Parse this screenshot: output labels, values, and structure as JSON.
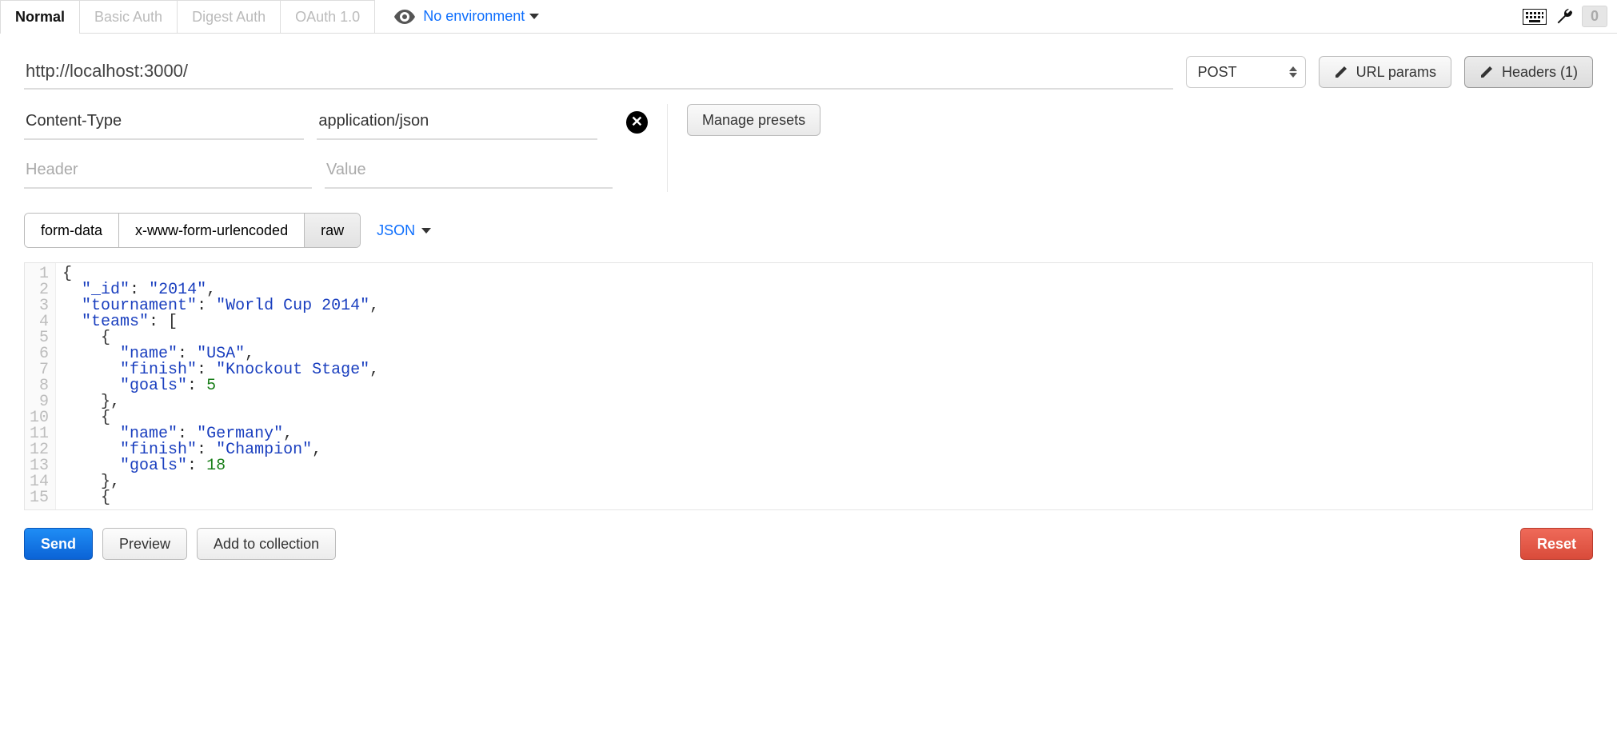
{
  "tabs": {
    "auth": {
      "normal": "Normal",
      "basic": "Basic Auth",
      "digest": "Digest Auth",
      "oauth": "OAuth 1.0",
      "active": "normal"
    },
    "environment": {
      "label": "No environment"
    }
  },
  "top_right": {
    "count": "0"
  },
  "request": {
    "url": "http://localhost:3000/",
    "method_selected": "POST"
  },
  "toolbar": {
    "url_params": "URL params",
    "headers_btn": "Headers (1)"
  },
  "headers": {
    "rows": [
      {
        "name": "Content-Type",
        "value": "application/json"
      }
    ],
    "placeholder_name": "Header",
    "placeholder_value": "Value",
    "manage_presets": "Manage presets"
  },
  "body_tabs": {
    "form_data": "form-data",
    "urlencoded": "x-www-form-urlencoded",
    "raw": "raw",
    "active": "raw",
    "body_type": "JSON"
  },
  "editor": {
    "lines": [
      [
        {
          "t": "brace",
          "v": "{"
        }
      ],
      [
        {
          "t": "pad",
          "v": "  "
        },
        {
          "t": "key",
          "v": "\"_id\""
        },
        {
          "t": "punc",
          "v": ": "
        },
        {
          "t": "str",
          "v": "\"2014\""
        },
        {
          "t": "punc",
          "v": ","
        }
      ],
      [
        {
          "t": "pad",
          "v": "  "
        },
        {
          "t": "key",
          "v": "\"tournament\""
        },
        {
          "t": "punc",
          "v": ": "
        },
        {
          "t": "str",
          "v": "\"World Cup 2014\""
        },
        {
          "t": "punc",
          "v": ","
        }
      ],
      [
        {
          "t": "pad",
          "v": "  "
        },
        {
          "t": "key",
          "v": "\"teams\""
        },
        {
          "t": "punc",
          "v": ": ["
        }
      ],
      [
        {
          "t": "pad",
          "v": "    "
        },
        {
          "t": "brace",
          "v": "{"
        }
      ],
      [
        {
          "t": "pad",
          "v": "      "
        },
        {
          "t": "key",
          "v": "\"name\""
        },
        {
          "t": "punc",
          "v": ": "
        },
        {
          "t": "str",
          "v": "\"USA\""
        },
        {
          "t": "punc",
          "v": ","
        }
      ],
      [
        {
          "t": "pad",
          "v": "      "
        },
        {
          "t": "key",
          "v": "\"finish\""
        },
        {
          "t": "punc",
          "v": ": "
        },
        {
          "t": "str",
          "v": "\"Knockout Stage\""
        },
        {
          "t": "punc",
          "v": ","
        }
      ],
      [
        {
          "t": "pad",
          "v": "      "
        },
        {
          "t": "key",
          "v": "\"goals\""
        },
        {
          "t": "punc",
          "v": ": "
        },
        {
          "t": "num",
          "v": "5"
        }
      ],
      [
        {
          "t": "pad",
          "v": "    "
        },
        {
          "t": "brace",
          "v": "}"
        },
        {
          "t": "punc",
          "v": ","
        }
      ],
      [
        {
          "t": "pad",
          "v": "    "
        },
        {
          "t": "brace",
          "v": "{"
        }
      ],
      [
        {
          "t": "pad",
          "v": "      "
        },
        {
          "t": "key",
          "v": "\"name\""
        },
        {
          "t": "punc",
          "v": ": "
        },
        {
          "t": "str",
          "v": "\"Germany\""
        },
        {
          "t": "punc",
          "v": ","
        }
      ],
      [
        {
          "t": "pad",
          "v": "      "
        },
        {
          "t": "key",
          "v": "\"finish\""
        },
        {
          "t": "punc",
          "v": ": "
        },
        {
          "t": "str",
          "v": "\"Champion\""
        },
        {
          "t": "punc",
          "v": ","
        }
      ],
      [
        {
          "t": "pad",
          "v": "      "
        },
        {
          "t": "key",
          "v": "\"goals\""
        },
        {
          "t": "punc",
          "v": ": "
        },
        {
          "t": "num",
          "v": "18"
        }
      ],
      [
        {
          "t": "pad",
          "v": "    "
        },
        {
          "t": "brace",
          "v": "}"
        },
        {
          "t": "punc",
          "v": ","
        }
      ],
      [
        {
          "t": "pad",
          "v": "    "
        },
        {
          "t": "brace",
          "v": "{"
        }
      ]
    ]
  },
  "footer": {
    "send": "Send",
    "preview": "Preview",
    "add_collection": "Add to collection",
    "reset": "Reset"
  }
}
